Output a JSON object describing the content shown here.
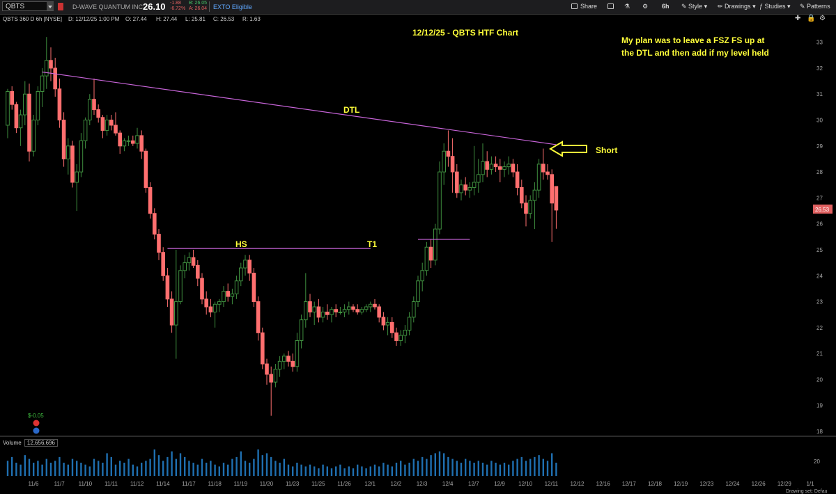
{
  "toolbar": {
    "symbol": "QBTS",
    "company": "D-WAVE QUANTUM INC",
    "price": "26.10",
    "change": "-1.88",
    "change_pct": "-6.72%",
    "bid": "B: 26.05",
    "ask": "A: 26.04",
    "eto_label": "EXTO Eligible",
    "share_label": "Share",
    "timeframe_label": "6h",
    "style_label": "Style",
    "drawings_label": "Drawings",
    "studies_label": "Studies",
    "patterns_label": "Patterns"
  },
  "info": {
    "title": "QBTS 360 D 6h [NYSE]",
    "date": "D: 12/12/25 1:00 PM",
    "open": "O: 27.44",
    "high": "H: 27.44",
    "low": "L: 25.81",
    "close": "C: 26.53",
    "range": "R: 1.63"
  },
  "annotations": {
    "chart_title": "12/12/25 - QBTS HTF Chart",
    "plan_line1": "My plan was to leave a FSZ FS up at",
    "plan_line2": "the DTL and then add if my level held",
    "dtl_label": "DTL",
    "hs_label": "HS",
    "t1_label": "T1",
    "short_label": "Short",
    "pl_label": "$-0.05"
  },
  "price_axis": {
    "ticks": [
      "33",
      "32",
      "31",
      "30",
      "29",
      "28",
      "27",
      "26",
      "25",
      "24",
      "23",
      "22",
      "21",
      "20",
      "19",
      "18"
    ],
    "last_price_tag": "26.53"
  },
  "volume": {
    "label": "Volume",
    "value": "12,656,696",
    "axis_tick": "20"
  },
  "date_axis": {
    "labels": [
      "11/6",
      "11/7",
      "11/10",
      "11/11",
      "11/12",
      "11/14",
      "11/17",
      "11/18",
      "11/19",
      "11/20",
      "11/23",
      "11/25",
      "11/26",
      "12/1",
      "12/2",
      "12/3",
      "12/4",
      "12/7",
      "12/9",
      "12/10",
      "12/11",
      "12/12",
      "12/16",
      "12/17",
      "12/18",
      "12/19",
      "12/23",
      "12/24",
      "12/26",
      "12/29",
      "1/1"
    ]
  },
  "footer": {
    "drawing_set": "Drawing set: Defau"
  },
  "colors": {
    "up": "#3f8f3f",
    "down": "#ff6f6f",
    "volume": "#1f6fb0",
    "trendline": "#c764d8",
    "annotation": "#ffff3a"
  },
  "chart_data": {
    "type": "candlestick",
    "ylim": [
      18,
      33.5
    ],
    "candles": [
      {
        "o": 29.8,
        "h": 31.2,
        "l": 29.3,
        "c": 31.1
      },
      {
        "o": 31.1,
        "h": 31.3,
        "l": 30.4,
        "c": 30.6
      },
      {
        "o": 30.6,
        "h": 30.7,
        "l": 29.5,
        "c": 29.7
      },
      {
        "o": 29.7,
        "h": 30.4,
        "l": 29.0,
        "c": 30.2
      },
      {
        "o": 30.2,
        "h": 31.5,
        "l": 29.8,
        "c": 31.0
      },
      {
        "o": 31.0,
        "h": 31.4,
        "l": 28.4,
        "c": 28.8
      },
      {
        "o": 28.8,
        "h": 30.2,
        "l": 28.6,
        "c": 30.0
      },
      {
        "o": 30.0,
        "h": 31.3,
        "l": 29.8,
        "c": 31.1
      },
      {
        "o": 31.1,
        "h": 32.0,
        "l": 30.5,
        "c": 31.7
      },
      {
        "o": 31.7,
        "h": 33.2,
        "l": 31.2,
        "c": 32.3
      },
      {
        "o": 32.3,
        "h": 32.8,
        "l": 31.5,
        "c": 32.0
      },
      {
        "o": 32.0,
        "h": 32.4,
        "l": 30.9,
        "c": 31.2
      },
      {
        "o": 31.2,
        "h": 31.6,
        "l": 29.7,
        "c": 30.0
      },
      {
        "o": 30.0,
        "h": 30.3,
        "l": 28.2,
        "c": 28.5
      },
      {
        "o": 28.5,
        "h": 29.3,
        "l": 27.9,
        "c": 29.0
      },
      {
        "o": 29.0,
        "h": 29.2,
        "l": 27.4,
        "c": 27.6
      },
      {
        "o": 27.6,
        "h": 28.3,
        "l": 26.5,
        "c": 28.0
      },
      {
        "o": 28.0,
        "h": 29.5,
        "l": 27.8,
        "c": 29.2
      },
      {
        "o": 29.2,
        "h": 30.1,
        "l": 28.9,
        "c": 30.0
      },
      {
        "o": 30.0,
        "h": 31.0,
        "l": 29.8,
        "c": 30.8
      },
      {
        "o": 30.8,
        "h": 31.6,
        "l": 30.2,
        "c": 30.4
      },
      {
        "o": 30.4,
        "h": 30.6,
        "l": 29.9,
        "c": 30.1
      },
      {
        "o": 30.1,
        "h": 30.2,
        "l": 29.3,
        "c": 29.6
      },
      {
        "o": 29.6,
        "h": 30.2,
        "l": 29.4,
        "c": 30.0
      },
      {
        "o": 30.0,
        "h": 30.2,
        "l": 29.6,
        "c": 29.8
      },
      {
        "o": 29.8,
        "h": 30.3,
        "l": 29.4,
        "c": 29.5
      },
      {
        "o": 29.5,
        "h": 29.6,
        "l": 28.7,
        "c": 29.0
      },
      {
        "o": 29.0,
        "h": 29.3,
        "l": 28.8,
        "c": 29.2
      },
      {
        "o": 29.2,
        "h": 29.4,
        "l": 29.0,
        "c": 29.2
      },
      {
        "o": 29.2,
        "h": 29.4,
        "l": 29.0,
        "c": 29.1
      },
      {
        "o": 29.1,
        "h": 29.7,
        "l": 28.9,
        "c": 29.4
      },
      {
        "o": 29.4,
        "h": 29.6,
        "l": 28.5,
        "c": 28.8
      },
      {
        "o": 28.8,
        "h": 28.9,
        "l": 27.2,
        "c": 27.4
      },
      {
        "o": 27.4,
        "h": 27.6,
        "l": 26.2,
        "c": 26.4
      },
      {
        "o": 26.4,
        "h": 26.6,
        "l": 25.4,
        "c": 25.6
      },
      {
        "o": 25.6,
        "h": 25.8,
        "l": 24.6,
        "c": 24.9
      },
      {
        "o": 24.9,
        "h": 25.1,
        "l": 23.8,
        "c": 24.0
      },
      {
        "o": 24.0,
        "h": 24.3,
        "l": 22.8,
        "c": 23.1
      },
      {
        "o": 23.1,
        "h": 23.4,
        "l": 21.8,
        "c": 22.1
      },
      {
        "o": 22.1,
        "h": 25.0,
        "l": 20.8,
        "c": 23.0
      },
      {
        "o": 23.0,
        "h": 24.4,
        "l": 22.9,
        "c": 24.2
      },
      {
        "o": 24.2,
        "h": 24.8,
        "l": 23.9,
        "c": 24.5
      },
      {
        "o": 24.5,
        "h": 24.9,
        "l": 24.2,
        "c": 24.7
      },
      {
        "o": 24.7,
        "h": 25.0,
        "l": 24.3,
        "c": 24.4
      },
      {
        "o": 24.4,
        "h": 24.6,
        "l": 23.6,
        "c": 23.9
      },
      {
        "o": 23.9,
        "h": 24.1,
        "l": 22.9,
        "c": 23.1
      },
      {
        "o": 23.1,
        "h": 23.4,
        "l": 22.5,
        "c": 22.8
      },
      {
        "o": 22.8,
        "h": 23.1,
        "l": 22.4,
        "c": 22.6
      },
      {
        "o": 22.6,
        "h": 23.0,
        "l": 22.0,
        "c": 22.9
      },
      {
        "o": 22.9,
        "h": 23.1,
        "l": 22.6,
        "c": 23.0
      },
      {
        "o": 23.0,
        "h": 23.6,
        "l": 22.8,
        "c": 23.4
      },
      {
        "o": 23.4,
        "h": 23.7,
        "l": 23.0,
        "c": 23.2
      },
      {
        "o": 23.2,
        "h": 23.5,
        "l": 22.9,
        "c": 23.3
      },
      {
        "o": 23.3,
        "h": 24.0,
        "l": 23.1,
        "c": 23.8
      },
      {
        "o": 23.8,
        "h": 24.5,
        "l": 23.6,
        "c": 24.3
      },
      {
        "o": 24.3,
        "h": 24.8,
        "l": 24.0,
        "c": 24.6
      },
      {
        "o": 24.6,
        "h": 24.8,
        "l": 23.8,
        "c": 24.1
      },
      {
        "o": 24.1,
        "h": 24.3,
        "l": 22.8,
        "c": 23.0
      },
      {
        "o": 23.0,
        "h": 23.2,
        "l": 21.5,
        "c": 21.8
      },
      {
        "o": 21.8,
        "h": 22.0,
        "l": 20.4,
        "c": 20.6
      },
      {
        "o": 20.6,
        "h": 20.8,
        "l": 19.8,
        "c": 20.2
      },
      {
        "o": 20.2,
        "h": 20.5,
        "l": 18.6,
        "c": 19.9
      },
      {
        "o": 19.9,
        "h": 20.6,
        "l": 19.7,
        "c": 20.4
      },
      {
        "o": 20.4,
        "h": 20.9,
        "l": 20.1,
        "c": 20.7
      },
      {
        "o": 20.7,
        "h": 21.0,
        "l": 20.4,
        "c": 20.9
      },
      {
        "o": 20.9,
        "h": 21.1,
        "l": 20.5,
        "c": 20.7
      },
      {
        "o": 20.7,
        "h": 21.0,
        "l": 20.3,
        "c": 20.5
      },
      {
        "o": 20.5,
        "h": 21.8,
        "l": 20.3,
        "c": 21.5
      },
      {
        "o": 21.5,
        "h": 22.5,
        "l": 21.2,
        "c": 22.3
      },
      {
        "o": 22.3,
        "h": 24.1,
        "l": 22.0,
        "c": 23.0
      },
      {
        "o": 23.0,
        "h": 23.3,
        "l": 22.4,
        "c": 22.6
      },
      {
        "o": 22.6,
        "h": 23.0,
        "l": 22.1,
        "c": 22.8
      },
      {
        "o": 22.8,
        "h": 23.1,
        "l": 22.2,
        "c": 22.4
      },
      {
        "o": 22.4,
        "h": 22.8,
        "l": 22.2,
        "c": 22.6
      },
      {
        "o": 22.6,
        "h": 22.9,
        "l": 22.3,
        "c": 22.5
      },
      {
        "o": 22.5,
        "h": 22.8,
        "l": 22.2,
        "c": 22.7
      },
      {
        "o": 22.7,
        "h": 22.9,
        "l": 22.4,
        "c": 22.6
      },
      {
        "o": 22.6,
        "h": 22.8,
        "l": 22.5,
        "c": 22.6
      },
      {
        "o": 22.6,
        "h": 22.9,
        "l": 22.4,
        "c": 22.7
      },
      {
        "o": 22.7,
        "h": 23.0,
        "l": 22.5,
        "c": 22.8
      },
      {
        "o": 22.8,
        "h": 22.9,
        "l": 22.6,
        "c": 22.7
      },
      {
        "o": 22.7,
        "h": 22.9,
        "l": 22.5,
        "c": 22.6
      },
      {
        "o": 22.6,
        "h": 22.8,
        "l": 22.5,
        "c": 22.7
      },
      {
        "o": 22.7,
        "h": 22.9,
        "l": 22.6,
        "c": 22.8
      },
      {
        "o": 22.8,
        "h": 23.0,
        "l": 22.6,
        "c": 22.9
      },
      {
        "o": 22.9,
        "h": 23.1,
        "l": 22.7,
        "c": 22.8
      },
      {
        "o": 22.8,
        "h": 22.9,
        "l": 22.2,
        "c": 22.4
      },
      {
        "o": 22.4,
        "h": 22.6,
        "l": 21.9,
        "c": 22.1
      },
      {
        "o": 22.1,
        "h": 22.4,
        "l": 21.7,
        "c": 22.2
      },
      {
        "o": 22.2,
        "h": 22.4,
        "l": 21.6,
        "c": 21.8
      },
      {
        "o": 21.8,
        "h": 22.0,
        "l": 21.3,
        "c": 21.5
      },
      {
        "o": 21.5,
        "h": 21.9,
        "l": 21.3,
        "c": 21.7
      },
      {
        "o": 21.7,
        "h": 22.1,
        "l": 21.4,
        "c": 21.9
      },
      {
        "o": 21.9,
        "h": 22.6,
        "l": 21.7,
        "c": 22.4
      },
      {
        "o": 22.4,
        "h": 23.2,
        "l": 22.2,
        "c": 23.0
      },
      {
        "o": 23.0,
        "h": 24.0,
        "l": 22.8,
        "c": 23.8
      },
      {
        "o": 23.8,
        "h": 24.5,
        "l": 23.4,
        "c": 24.2
      },
      {
        "o": 24.2,
        "h": 25.3,
        "l": 24.0,
        "c": 25.1
      },
      {
        "o": 25.1,
        "h": 25.4,
        "l": 24.3,
        "c": 24.6
      },
      {
        "o": 24.6,
        "h": 26.0,
        "l": 24.4,
        "c": 25.8
      },
      {
        "o": 25.8,
        "h": 28.4,
        "l": 25.6,
        "c": 28.0
      },
      {
        "o": 28.0,
        "h": 29.1,
        "l": 27.5,
        "c": 28.8
      },
      {
        "o": 28.8,
        "h": 29.6,
        "l": 28.2,
        "c": 28.6
      },
      {
        "o": 28.6,
        "h": 29.3,
        "l": 27.2,
        "c": 28.0
      },
      {
        "o": 28.0,
        "h": 28.3,
        "l": 27.0,
        "c": 27.2
      },
      {
        "o": 27.2,
        "h": 27.7,
        "l": 26.9,
        "c": 27.5
      },
      {
        "o": 27.5,
        "h": 27.8,
        "l": 27.1,
        "c": 27.3
      },
      {
        "o": 27.3,
        "h": 27.6,
        "l": 27.0,
        "c": 27.4
      },
      {
        "o": 27.4,
        "h": 29.0,
        "l": 27.1,
        "c": 27.6
      },
      {
        "o": 27.6,
        "h": 28.5,
        "l": 27.2,
        "c": 27.9
      },
      {
        "o": 27.9,
        "h": 29.1,
        "l": 27.6,
        "c": 28.4
      },
      {
        "o": 28.4,
        "h": 28.8,
        "l": 27.8,
        "c": 28.1
      },
      {
        "o": 28.1,
        "h": 28.6,
        "l": 27.9,
        "c": 28.3
      },
      {
        "o": 28.3,
        "h": 28.6,
        "l": 28.0,
        "c": 28.2
      },
      {
        "o": 28.2,
        "h": 28.5,
        "l": 27.6,
        "c": 28.1
      },
      {
        "o": 28.1,
        "h": 28.4,
        "l": 27.8,
        "c": 28.2
      },
      {
        "o": 28.2,
        "h": 28.6,
        "l": 27.9,
        "c": 28.3
      },
      {
        "o": 28.3,
        "h": 28.5,
        "l": 27.8,
        "c": 28.0
      },
      {
        "o": 28.0,
        "h": 28.3,
        "l": 27.1,
        "c": 27.4
      },
      {
        "o": 27.4,
        "h": 27.7,
        "l": 26.6,
        "c": 26.8
      },
      {
        "o": 26.8,
        "h": 27.1,
        "l": 25.9,
        "c": 26.4
      },
      {
        "o": 26.4,
        "h": 27.1,
        "l": 26.2,
        "c": 26.9
      },
      {
        "o": 26.9,
        "h": 27.6,
        "l": 25.8,
        "c": 27.3
      },
      {
        "o": 27.3,
        "h": 28.5,
        "l": 27.0,
        "c": 28.3
      },
      {
        "o": 28.3,
        "h": 28.9,
        "l": 27.7,
        "c": 28.0
      },
      {
        "o": 28.0,
        "h": 28.3,
        "l": 27.7,
        "c": 27.9
      },
      {
        "o": 27.9,
        "h": 28.1,
        "l": 25.3,
        "c": 26.8
      },
      {
        "o": 27.44,
        "h": 27.44,
        "l": 25.81,
        "c": 26.53
      }
    ],
    "volumes": [
      8,
      10,
      7,
      6,
      11,
      9,
      7,
      8,
      6,
      9,
      7,
      8,
      10,
      7,
      6,
      9,
      8,
      7,
      6,
      5,
      9,
      8,
      7,
      12,
      10,
      6,
      8,
      7,
      9,
      6,
      5,
      7,
      8,
      9,
      14,
      11,
      8,
      10,
      13,
      9,
      12,
      10,
      8,
      7,
      6,
      9,
      7,
      8,
      6,
      5,
      7,
      6,
      9,
      10,
      13,
      8,
      7,
      9,
      14,
      11,
      12,
      10,
      8,
      7,
      9,
      6,
      5,
      7,
      6,
      5,
      6,
      5,
      4,
      6,
      5,
      4,
      5,
      6,
      4,
      5,
      4,
      6,
      5,
      4,
      5,
      6,
      5,
      7,
      6,
      5,
      7,
      8,
      6,
      7,
      9,
      8,
      10,
      9,
      11,
      12,
      13,
      12,
      10,
      9,
      8,
      7,
      9,
      8,
      7,
      8,
      7,
      6,
      8,
      7,
      6,
      7,
      6,
      8,
      9,
      10,
      8,
      9,
      10,
      11,
      9,
      8,
      12,
      7
    ],
    "annotations": [
      {
        "type": "line",
        "name": "DTL",
        "from": {
          "candle": 8,
          "price": 31.85
        },
        "to": {
          "candle": 127,
          "price": 29.05
        }
      },
      {
        "type": "line",
        "name": "HS",
        "from": {
          "candle": 37,
          "price": 25.05
        },
        "to": {
          "candle": 84,
          "price": 25.05
        }
      },
      {
        "type": "line",
        "name": "T1",
        "from": {
          "candle": 95,
          "price": 25.4
        },
        "to": {
          "candle": 107,
          "price": 25.4
        }
      }
    ]
  }
}
